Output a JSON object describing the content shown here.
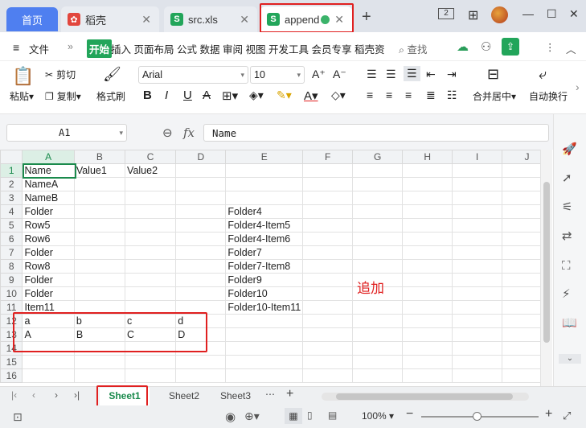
{
  "tabs": {
    "home": "首页",
    "daoke": "稻壳",
    "file1": "src.xls",
    "file2": "append"
  },
  "window": {
    "page_badge": "2"
  },
  "menu": {
    "file": "文件",
    "start": "开始",
    "items": [
      "插入",
      "页面布局",
      "公式",
      "数据",
      "审阅",
      "视图",
      "开发工具",
      "会员专享",
      "稻壳资"
    ],
    "search": "查找"
  },
  "toolbar": {
    "paste": "粘贴",
    "cut": "剪切",
    "copy": "复制",
    "format_painter": "格式刷",
    "font": "Arial",
    "size": "10",
    "merge": "合并居中",
    "wrap": "自动换行"
  },
  "formula": {
    "cell_ref": "A1",
    "fx": "fx",
    "content": "Name"
  },
  "columns": [
    "A",
    "B",
    "C",
    "D",
    "E",
    "F",
    "G",
    "H",
    "I",
    "J"
  ],
  "rows": [
    [
      "Name",
      "Value1",
      "Value2",
      "",
      "",
      "",
      "",
      "",
      "",
      ""
    ],
    [
      "NameA",
      "",
      "",
      "",
      "",
      "",
      "",
      "",
      "",
      ""
    ],
    [
      "NameB",
      "",
      "",
      "",
      "",
      "",
      "",
      "",
      "",
      ""
    ],
    [
      "Folder",
      "",
      "",
      "",
      "Folder4",
      "",
      "",
      "",
      "",
      ""
    ],
    [
      "Row5",
      "",
      "",
      "",
      "Folder4-Item5",
      "",
      "",
      "",
      "",
      ""
    ],
    [
      "Row6",
      "",
      "",
      "",
      "Folder4-Item6",
      "",
      "",
      "",
      "",
      ""
    ],
    [
      "Folder",
      "",
      "",
      "",
      "Folder7",
      "",
      "",
      "",
      "",
      ""
    ],
    [
      "Row8",
      "",
      "",
      "",
      "Folder7-Item8",
      "",
      "",
      "",
      "",
      ""
    ],
    [
      "Folder",
      "",
      "",
      "",
      "Folder9",
      "",
      "",
      "",
      "",
      ""
    ],
    [
      "Folder",
      "",
      "",
      "",
      "Folder10",
      "",
      "",
      "",
      "",
      ""
    ],
    [
      "Item11",
      "",
      "",
      "",
      "Folder10-Item11",
      "",
      "",
      "",
      "",
      ""
    ],
    [
      "a",
      "b",
      "c",
      "d",
      "",
      "",
      "",
      "",
      "",
      ""
    ],
    [
      "A",
      "B",
      "C",
      "D",
      "",
      "",
      "",
      "",
      "",
      ""
    ],
    [
      "",
      "",
      "",
      "",
      "",
      "",
      "",
      "",
      "",
      ""
    ],
    [
      "",
      "",
      "",
      "",
      "",
      "",
      "",
      "",
      "",
      ""
    ],
    [
      "",
      "",
      "",
      "",
      "",
      "",
      "",
      "",
      "",
      ""
    ]
  ],
  "annotation": "追加",
  "sheets": [
    "Sheet1",
    "Sheet2",
    "Sheet3"
  ],
  "status": {
    "zoom": "100%"
  },
  "colors": {
    "accent": "#1a8a4c",
    "highlight": "#e02020",
    "home_tab": "#4f7ff0"
  }
}
